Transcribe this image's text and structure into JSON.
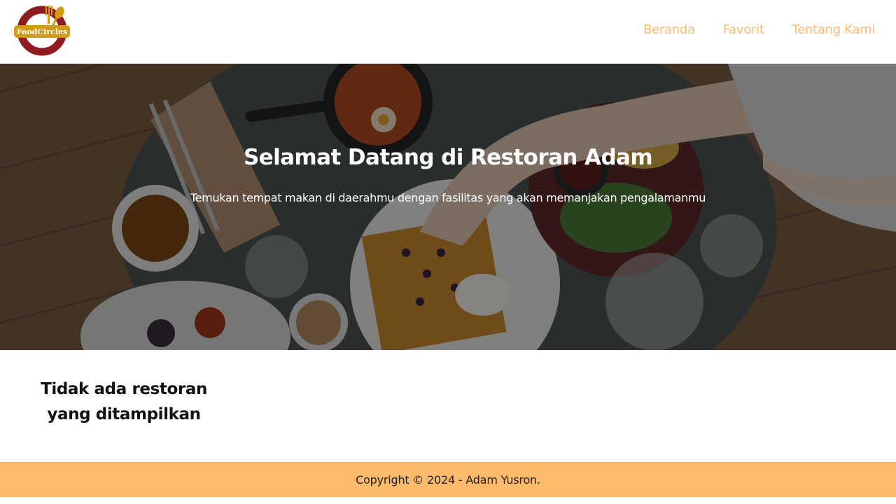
{
  "app": {
    "logo_text": "FoodCircles"
  },
  "nav": {
    "items": [
      {
        "label": "Beranda"
      },
      {
        "label": "Favorit"
      },
      {
        "label": "Tentang Kami"
      }
    ]
  },
  "hero": {
    "title": "Selamat Datang di Restoran Adam",
    "subtitle": "Temukan tempat makan di daerahmu dengan fasilitas yang akan memanjakan pengalamanmu"
  },
  "main": {
    "empty_message": "Tidak ada restoran yang ditampilkan"
  },
  "footer": {
    "copyright": "Copyright © 2024 - Adam Yusron."
  },
  "colors": {
    "accent": "#ffbb6b",
    "brand_red": "#8e1c22",
    "brand_gold": "#d19a13"
  },
  "icons": {
    "logo": "foodcircles-logo-icon"
  }
}
